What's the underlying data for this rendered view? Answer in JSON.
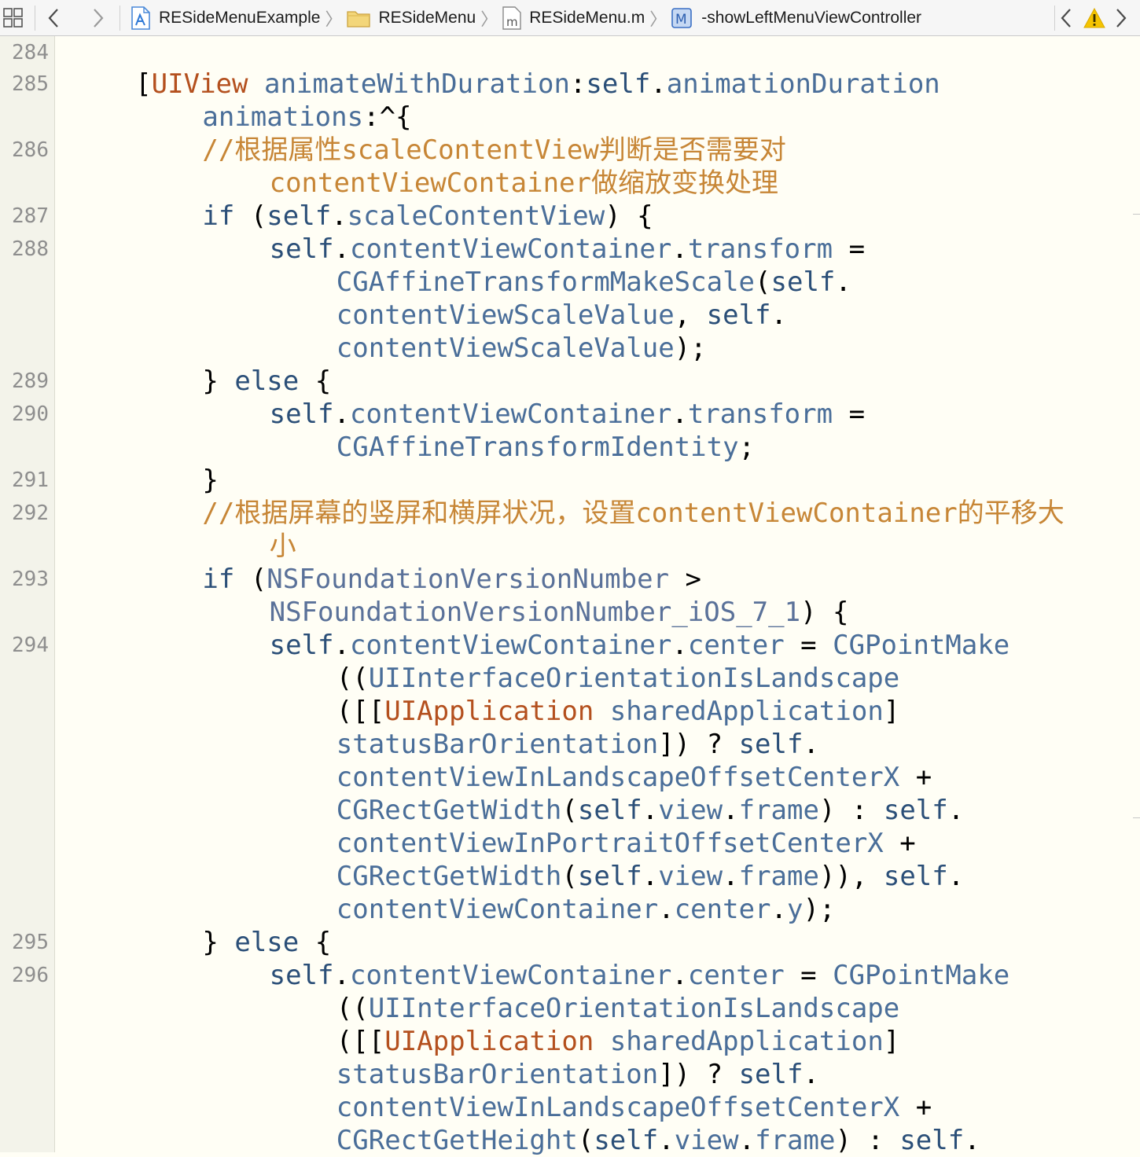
{
  "jump_bar": {
    "grid_icon": "related-items-grid-icon",
    "back_icon": "chevron-left-icon",
    "forward_icon": "chevron-right-icon",
    "breadcrumbs": [
      {
        "label": "RESideMenuExample",
        "icon": "xcode-project-icon"
      },
      {
        "label": "RESideMenu",
        "icon": "folder-icon"
      },
      {
        "label": "RESideMenu.m",
        "icon": "objc-implementation-file-icon"
      },
      {
        "label": "-showLeftMenuViewController",
        "icon": "method-icon"
      }
    ],
    "method_icon_letter": "M",
    "file_icon_letter": "m",
    "issue_prev_icon": "chevron-left-icon",
    "warning_icon": "warning-triangle-icon",
    "issue_next_icon": "chevron-right-icon"
  },
  "colors": {
    "keyword": "#2b4f78",
    "class": "#b4501e",
    "function": "#4a6e99",
    "comment": "#c78636",
    "plain": "#000000",
    "background": "#fffef5",
    "warning": "#f5c400"
  },
  "editor": {
    "line_numbers": [
      "284",
      "285",
      "286",
      "287",
      "288",
      "289",
      "290",
      "291",
      "292",
      "293",
      "294",
      "295",
      "296"
    ],
    "rows": [
      {
        "ln": "284",
        "indent": 0,
        "tokens": []
      },
      {
        "ln": "285",
        "indent": 4,
        "tokens": [
          [
            "p",
            "["
          ],
          [
            "c",
            "UIView"
          ],
          [
            "p",
            " "
          ],
          [
            "f",
            "animateWithDuration"
          ],
          [
            "p",
            ":"
          ],
          [
            "k",
            "self"
          ],
          [
            "p",
            "."
          ],
          [
            "f",
            "animationDuration"
          ]
        ]
      },
      {
        "ln": "",
        "indent": 8,
        "tokens": [
          [
            "f",
            "animations"
          ],
          [
            "p",
            ":^{"
          ]
        ]
      },
      {
        "ln": "286",
        "indent": 8,
        "tokens": [
          [
            "m",
            "//根据属性scaleContentView判断是否需要对"
          ]
        ]
      },
      {
        "ln": "",
        "indent": 12,
        "tokens": [
          [
            "m",
            "contentViewContainer做缩放变换处理"
          ]
        ]
      },
      {
        "ln": "287",
        "indent": 8,
        "tokens": [
          [
            "k",
            "if"
          ],
          [
            "p",
            " ("
          ],
          [
            "k",
            "self"
          ],
          [
            "p",
            "."
          ],
          [
            "f",
            "scaleContentView"
          ],
          [
            "p",
            ") {"
          ]
        ]
      },
      {
        "ln": "288",
        "indent": 12,
        "tokens": [
          [
            "k",
            "self"
          ],
          [
            "p",
            "."
          ],
          [
            "f",
            "contentViewContainer"
          ],
          [
            "p",
            "."
          ],
          [
            "f",
            "transform"
          ],
          [
            "p",
            " ="
          ]
        ]
      },
      {
        "ln": "",
        "indent": 16,
        "tokens": [
          [
            "f",
            "CGAffineTransformMakeScale"
          ],
          [
            "p",
            "("
          ],
          [
            "k",
            "self"
          ],
          [
            "p",
            "."
          ]
        ]
      },
      {
        "ln": "",
        "indent": 16,
        "tokens": [
          [
            "f",
            "contentViewScaleValue"
          ],
          [
            "p",
            ", "
          ],
          [
            "k",
            "self"
          ],
          [
            "p",
            "."
          ]
        ]
      },
      {
        "ln": "",
        "indent": 16,
        "tokens": [
          [
            "f",
            "contentViewScaleValue"
          ],
          [
            "p",
            ");"
          ]
        ]
      },
      {
        "ln": "289",
        "indent": 8,
        "tokens": [
          [
            "p",
            "} "
          ],
          [
            "k",
            "else"
          ],
          [
            "p",
            " {"
          ]
        ]
      },
      {
        "ln": "290",
        "indent": 12,
        "tokens": [
          [
            "k",
            "self"
          ],
          [
            "p",
            "."
          ],
          [
            "f",
            "contentViewContainer"
          ],
          [
            "p",
            "."
          ],
          [
            "f",
            "transform"
          ],
          [
            "p",
            " ="
          ]
        ]
      },
      {
        "ln": "",
        "indent": 16,
        "tokens": [
          [
            "f",
            "CGAffineTransformIdentity"
          ],
          [
            "p",
            ";"
          ]
        ]
      },
      {
        "ln": "291",
        "indent": 8,
        "tokens": [
          [
            "p",
            "}"
          ]
        ]
      },
      {
        "ln": "292",
        "indent": 8,
        "tokens": [
          [
            "m",
            "//根据屏幕的竖屏和横屏状况，设置contentViewContainer的平移大"
          ]
        ]
      },
      {
        "ln": "",
        "indent": 12,
        "tokens": [
          [
            "m",
            "小"
          ]
        ]
      },
      {
        "ln": "293",
        "indent": 8,
        "tokens": [
          [
            "k",
            "if"
          ],
          [
            "p",
            " ("
          ],
          [
            "n",
            "NSFoundationVersionNumber"
          ],
          [
            "p",
            " >"
          ]
        ]
      },
      {
        "ln": "",
        "indent": 12,
        "tokens": [
          [
            "n",
            "NSFoundationVersionNumber_iOS_7_1"
          ],
          [
            "p",
            ") {"
          ]
        ]
      },
      {
        "ln": "294",
        "indent": 12,
        "tokens": [
          [
            "k",
            "self"
          ],
          [
            "p",
            "."
          ],
          [
            "f",
            "contentViewContainer"
          ],
          [
            "p",
            "."
          ],
          [
            "f",
            "center"
          ],
          [
            "p",
            " = "
          ],
          [
            "f",
            "CGPointMake"
          ]
        ]
      },
      {
        "ln": "",
        "indent": 16,
        "tokens": [
          [
            "p",
            "(("
          ],
          [
            "f",
            "UIInterfaceOrientationIsLandscape"
          ]
        ]
      },
      {
        "ln": "",
        "indent": 16,
        "tokens": [
          [
            "p",
            "([["
          ],
          [
            "c",
            "UIApplication"
          ],
          [
            "p",
            " "
          ],
          [
            "f",
            "sharedApplication"
          ],
          [
            "p",
            "]"
          ]
        ]
      },
      {
        "ln": "",
        "indent": 16,
        "tokens": [
          [
            "f",
            "statusBarOrientation"
          ],
          [
            "p",
            "]) ? "
          ],
          [
            "k",
            "self"
          ],
          [
            "p",
            "."
          ]
        ]
      },
      {
        "ln": "",
        "indent": 16,
        "tokens": [
          [
            "f",
            "contentViewInLandscapeOffsetCenterX"
          ],
          [
            "p",
            " +"
          ]
        ]
      },
      {
        "ln": "",
        "indent": 16,
        "tokens": [
          [
            "f",
            "CGRectGetWidth"
          ],
          [
            "p",
            "("
          ],
          [
            "k",
            "self"
          ],
          [
            "p",
            "."
          ],
          [
            "f",
            "view"
          ],
          [
            "p",
            "."
          ],
          [
            "f",
            "frame"
          ],
          [
            "p",
            ") : "
          ],
          [
            "k",
            "self"
          ],
          [
            "p",
            "."
          ]
        ]
      },
      {
        "ln": "",
        "indent": 16,
        "tokens": [
          [
            "f",
            "contentViewInPortraitOffsetCenterX"
          ],
          [
            "p",
            " +"
          ]
        ]
      },
      {
        "ln": "",
        "indent": 16,
        "tokens": [
          [
            "f",
            "CGRectGetWidth"
          ],
          [
            "p",
            "("
          ],
          [
            "k",
            "self"
          ],
          [
            "p",
            "."
          ],
          [
            "f",
            "view"
          ],
          [
            "p",
            "."
          ],
          [
            "f",
            "frame"
          ],
          [
            "p",
            ")), "
          ],
          [
            "k",
            "self"
          ],
          [
            "p",
            "."
          ]
        ]
      },
      {
        "ln": "",
        "indent": 16,
        "tokens": [
          [
            "f",
            "contentViewContainer"
          ],
          [
            "p",
            "."
          ],
          [
            "f",
            "center"
          ],
          [
            "p",
            "."
          ],
          [
            "f",
            "y"
          ],
          [
            "p",
            ");"
          ]
        ]
      },
      {
        "ln": "295",
        "indent": 8,
        "tokens": [
          [
            "p",
            "} "
          ],
          [
            "k",
            "else"
          ],
          [
            "p",
            " {"
          ]
        ]
      },
      {
        "ln": "296",
        "indent": 12,
        "tokens": [
          [
            "k",
            "self"
          ],
          [
            "p",
            "."
          ],
          [
            "f",
            "contentViewContainer"
          ],
          [
            "p",
            "."
          ],
          [
            "f",
            "center"
          ],
          [
            "p",
            " = "
          ],
          [
            "f",
            "CGPointMake"
          ]
        ]
      },
      {
        "ln": "",
        "indent": 16,
        "tokens": [
          [
            "p",
            "(("
          ],
          [
            "f",
            "UIInterfaceOrientationIsLandscape"
          ]
        ]
      },
      {
        "ln": "",
        "indent": 16,
        "tokens": [
          [
            "p",
            "([["
          ],
          [
            "c",
            "UIApplication"
          ],
          [
            "p",
            " "
          ],
          [
            "f",
            "sharedApplication"
          ],
          [
            "p",
            "]"
          ]
        ]
      },
      {
        "ln": "",
        "indent": 16,
        "tokens": [
          [
            "f",
            "statusBarOrientation"
          ],
          [
            "p",
            "]) ? "
          ],
          [
            "k",
            "self"
          ],
          [
            "p",
            "."
          ]
        ]
      },
      {
        "ln": "",
        "indent": 16,
        "tokens": [
          [
            "f",
            "contentViewInLandscapeOffsetCenterX"
          ],
          [
            "p",
            " +"
          ]
        ]
      },
      {
        "ln": "",
        "indent": 16,
        "tokens": [
          [
            "f",
            "CGRectGetHeight"
          ],
          [
            "p",
            "("
          ],
          [
            "k",
            "self"
          ],
          [
            "p",
            "."
          ],
          [
            "f",
            "view"
          ],
          [
            "p",
            "."
          ],
          [
            "f",
            "frame"
          ],
          [
            "p",
            ") : "
          ],
          [
            "k",
            "self"
          ],
          [
            "p",
            "."
          ]
        ]
      }
    ]
  }
}
